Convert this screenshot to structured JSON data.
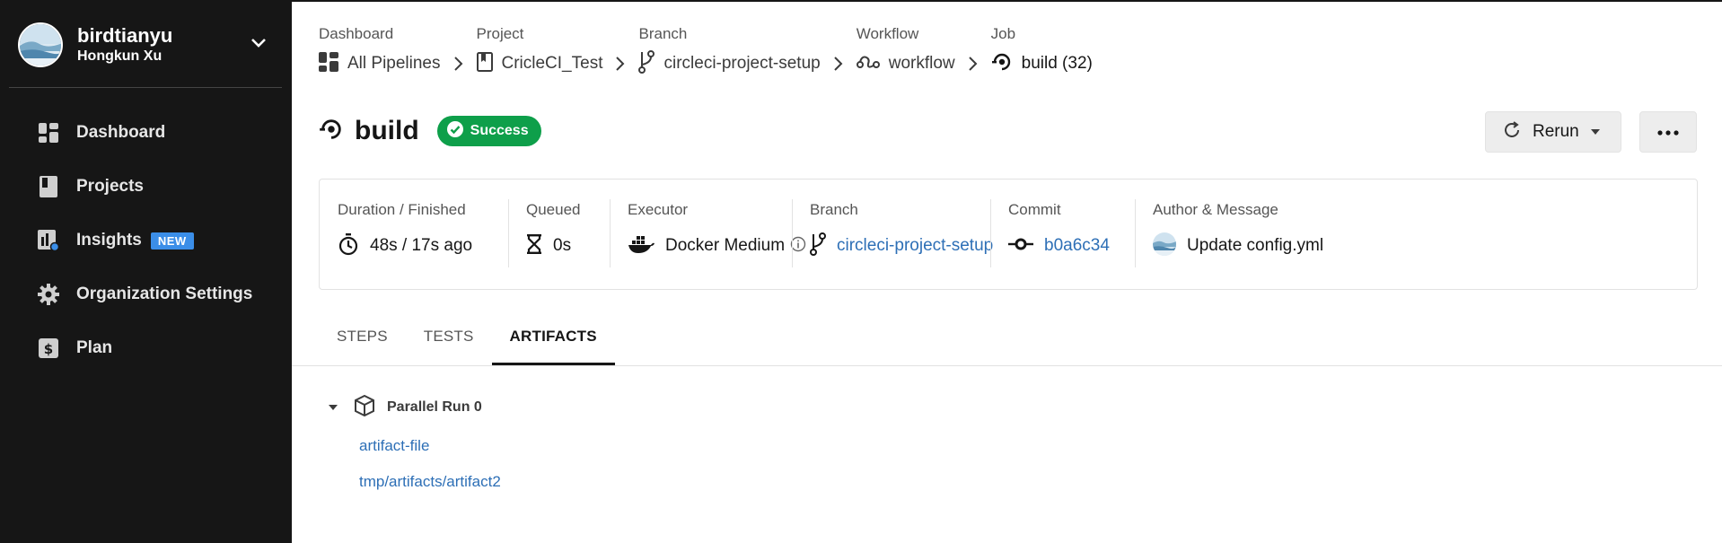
{
  "user": {
    "name": "birdtianyu",
    "subtitle": "Hongkun Xu"
  },
  "sidebar": {
    "items": [
      {
        "label": "Dashboard",
        "icon": "dashboard-icon"
      },
      {
        "label": "Projects",
        "icon": "projects-icon"
      },
      {
        "label": "Insights",
        "icon": "insights-icon",
        "badge": "NEW"
      },
      {
        "label": "Organization Settings",
        "icon": "gear-icon"
      },
      {
        "label": "Plan",
        "icon": "dollar-icon"
      }
    ]
  },
  "breadcrumb": [
    {
      "caption": "Dashboard",
      "value": "All Pipelines",
      "icon": "pipelines-icon"
    },
    {
      "caption": "Project",
      "value": "CricleCI_Test",
      "icon": "bookmark-icon"
    },
    {
      "caption": "Branch",
      "value": "circleci-project-setup",
      "icon": "branch-icon"
    },
    {
      "caption": "Workflow",
      "value": "workflow",
      "icon": "workflow-icon"
    },
    {
      "caption": "Job",
      "value": "build (32)",
      "icon": "job-icon"
    }
  ],
  "page": {
    "title": "build",
    "status": "Success"
  },
  "actions": {
    "rerun_label": "Rerun"
  },
  "info": {
    "duration": {
      "caption": "Duration / Finished",
      "value": "48s / 17s ago"
    },
    "queued": {
      "caption": "Queued",
      "value": "0s"
    },
    "executor": {
      "caption": "Executor",
      "value": "Docker Medium"
    },
    "branch": {
      "caption": "Branch",
      "value": "circleci-project-setup"
    },
    "commit": {
      "caption": "Commit",
      "value": "b0a6c34"
    },
    "author": {
      "caption": "Author & Message",
      "value": "Update config.yml"
    }
  },
  "tabs": [
    "STEPS",
    "TESTS",
    "ARTIFACTS"
  ],
  "artifacts": {
    "group_label": "Parallel Run 0",
    "files": [
      "artifact-file",
      "tmp/artifacts/artifact2"
    ]
  },
  "colors": {
    "sidebar_bg": "#161616",
    "success": "#0e9f4a",
    "link": "#2d6fb6",
    "badge": "#3b8ee8"
  }
}
